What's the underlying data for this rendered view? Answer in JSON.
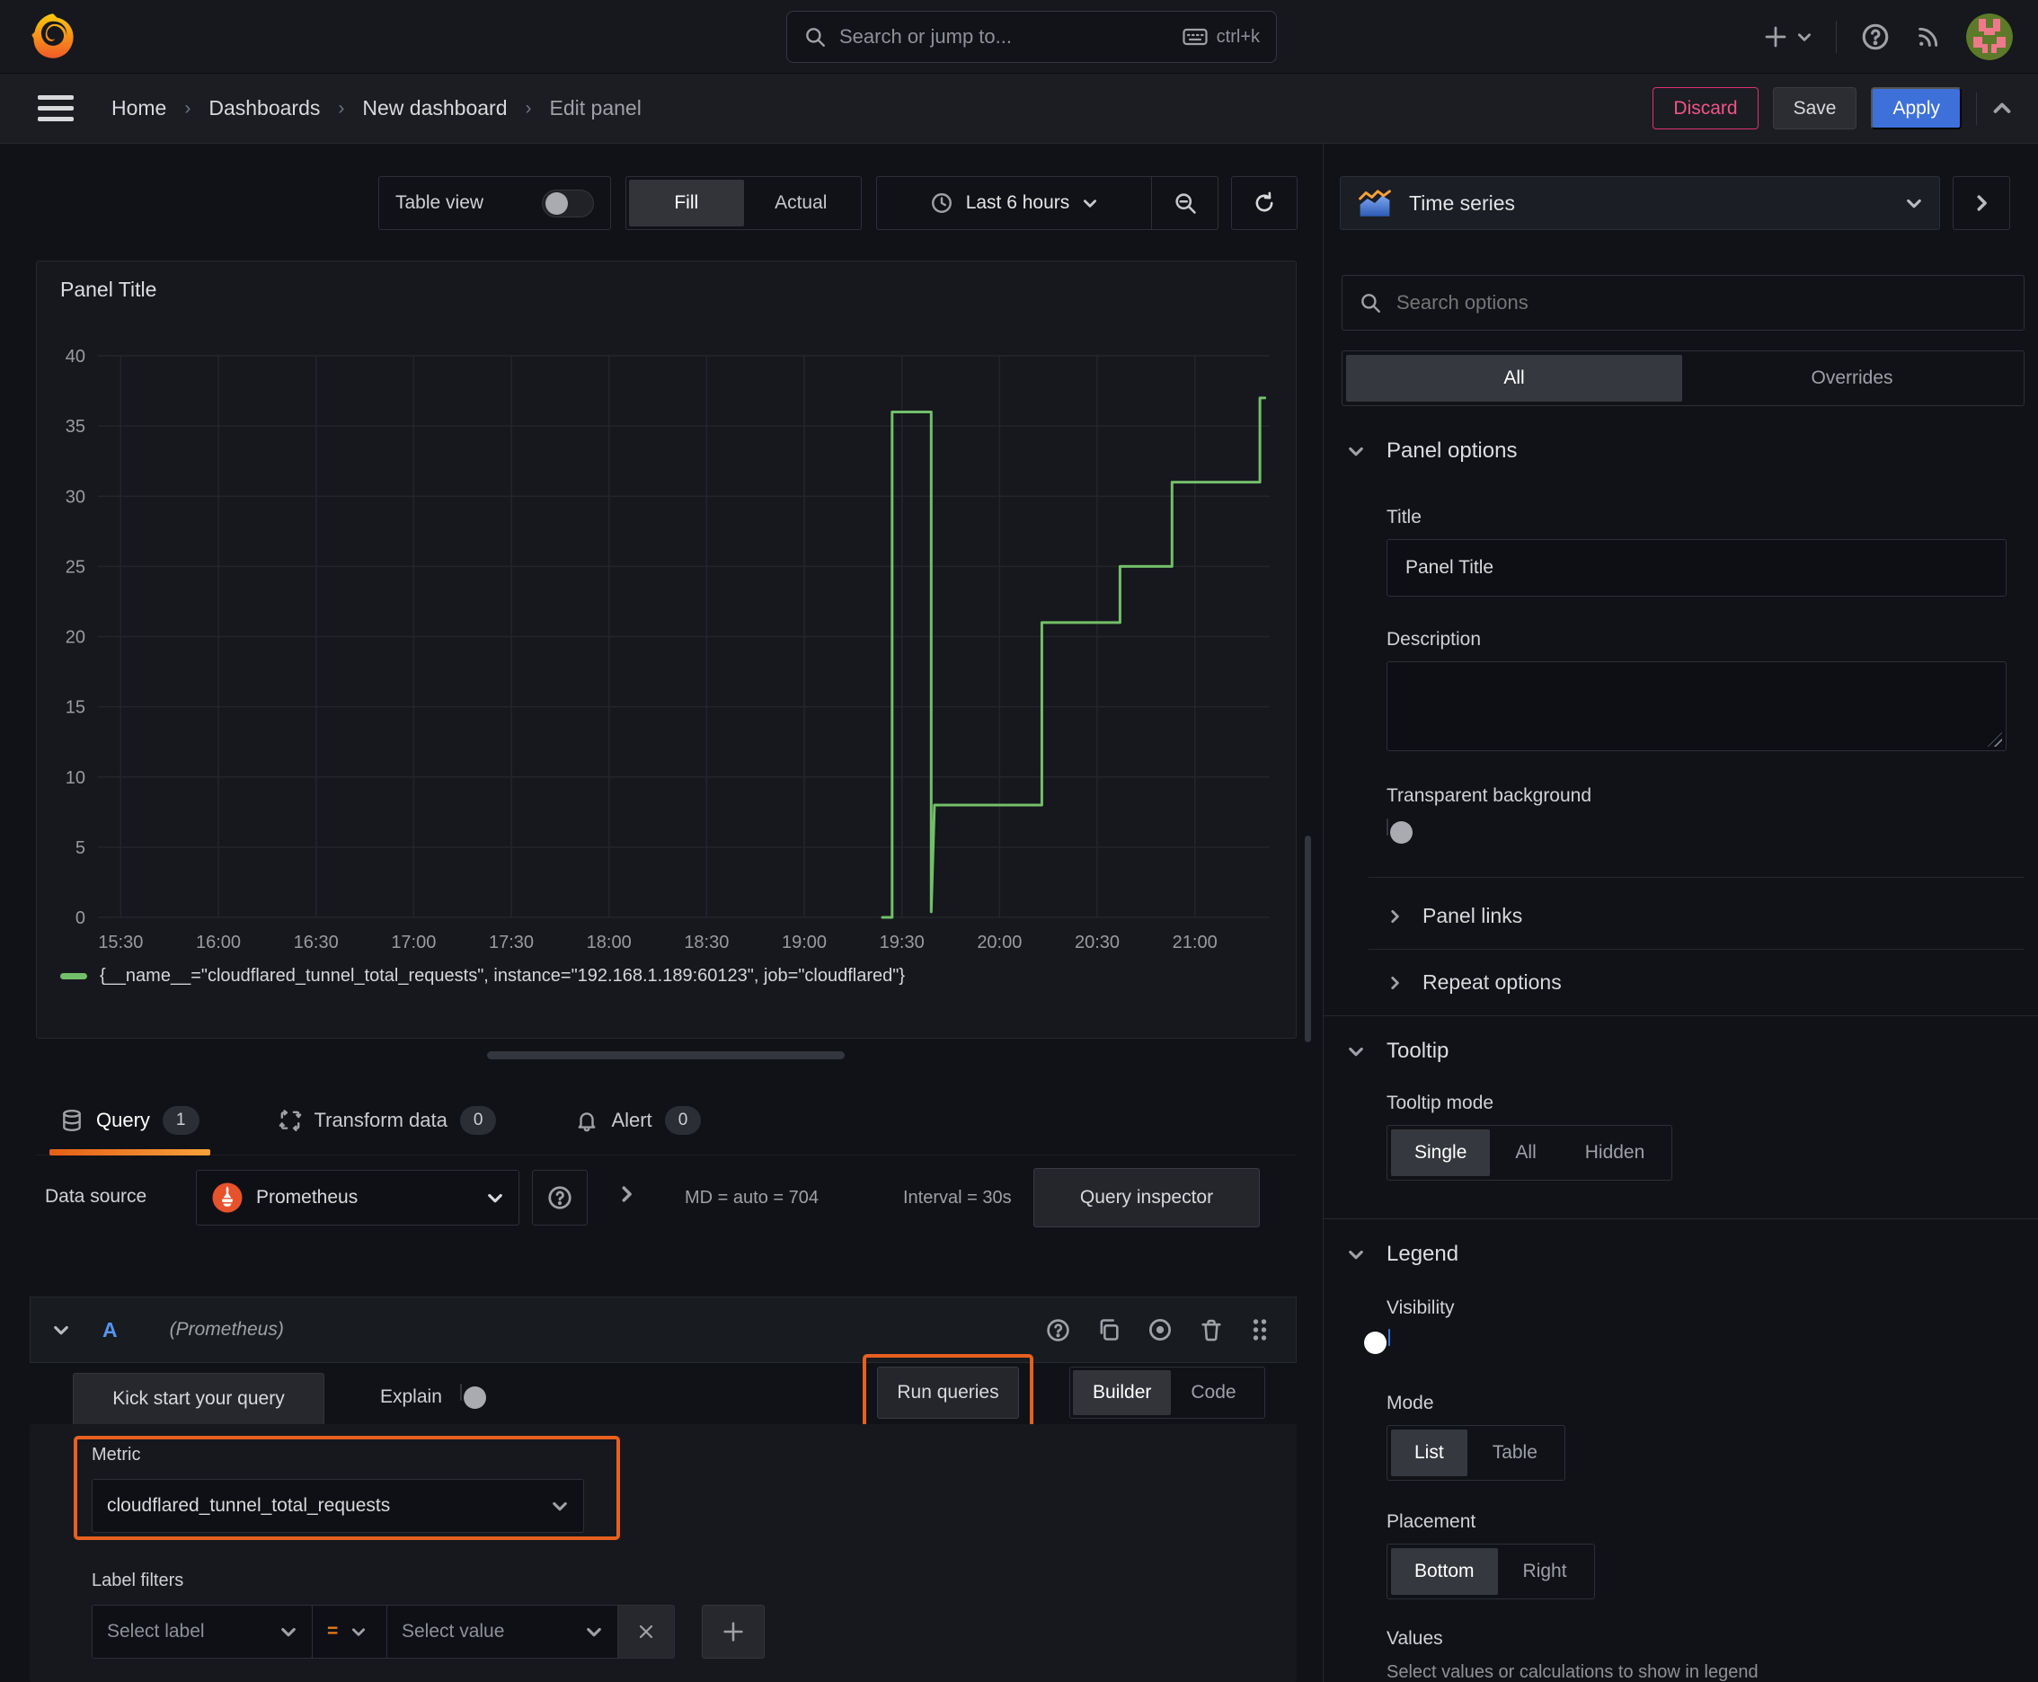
{
  "topbar": {
    "search_placeholder": "Search or jump to...",
    "shortcut": "ctrl+k"
  },
  "breadcrumb": {
    "items": [
      "Home",
      "Dashboards",
      "New dashboard"
    ],
    "current": "Edit panel"
  },
  "actions": {
    "discard": "Discard",
    "save": "Save",
    "apply": "Apply"
  },
  "toolbar": {
    "table_view": "Table view",
    "fill": "Fill",
    "actual": "Actual",
    "time_range": "Last 6 hours"
  },
  "panel": {
    "title": "Panel Title",
    "legend": "{__name__=\"cloudflared_tunnel_total_requests\", instance=\"192.168.1.189:60123\", job=\"cloudflared\"}"
  },
  "chart_data": {
    "type": "line",
    "style": "step",
    "title": "Panel Title",
    "xlabel": "",
    "ylabel": "",
    "ylim": [
      0,
      40
    ],
    "y_ticks": [
      0,
      5,
      10,
      15,
      20,
      25,
      30,
      35,
      40
    ],
    "x_ticks": [
      "15:30",
      "16:00",
      "16:30",
      "17:00",
      "17:30",
      "18:00",
      "18:30",
      "19:00",
      "19:30",
      "20:00",
      "20:30",
      "21:00"
    ],
    "x_tick_minutes": [
      0,
      30,
      60,
      90,
      120,
      150,
      180,
      210,
      240,
      270,
      300,
      330
    ],
    "x_domain_minutes": [
      -7,
      353
    ],
    "grid": true,
    "legend_position": "bottom",
    "series": [
      {
        "name": "{__name__=\"cloudflared_tunnel_total_requests\", instance=\"192.168.1.189:60123\", job=\"cloudflared\"}",
        "color": "#73bf69",
        "points": [
          {
            "t": "19:24",
            "m": 234,
            "v": 0
          },
          {
            "t": "19:27",
            "m": 237,
            "v": 0
          },
          {
            "t": "19:27",
            "m": 237,
            "v": 36
          },
          {
            "t": "19:39",
            "m": 249,
            "v": 36
          },
          {
            "t": "19:39",
            "m": 249,
            "v": 0.4
          },
          {
            "t": "19:40",
            "m": 250,
            "v": 8
          },
          {
            "t": "20:13",
            "m": 283,
            "v": 8
          },
          {
            "t": "20:13",
            "m": 283,
            "v": 21
          },
          {
            "t": "20:37",
            "m": 307,
            "v": 21
          },
          {
            "t": "20:37",
            "m": 307,
            "v": 25
          },
          {
            "t": "20:53",
            "m": 323,
            "v": 25
          },
          {
            "t": "20:53",
            "m": 323,
            "v": 31
          },
          {
            "t": "21:20",
            "m": 350,
            "v": 31
          },
          {
            "t": "21:20",
            "m": 350,
            "v": 37
          },
          {
            "t": "21:21",
            "m": 351.5,
            "v": 37
          }
        ]
      }
    ]
  },
  "tabs": [
    {
      "label": "Query",
      "count": "1"
    },
    {
      "label": "Transform data",
      "count": "0"
    },
    {
      "label": "Alert",
      "count": "0"
    }
  ],
  "query": {
    "datasource_label": "Data source",
    "datasource": "Prometheus",
    "stats_md": "MD = auto = 704",
    "stats_interval": "Interval = 30s",
    "inspector": "Query inspector",
    "ref_id": "A",
    "ds_hint": "(Prometheus)",
    "kickstart": "Kick start your query",
    "explain": "Explain",
    "run": "Run queries",
    "builder": "Builder",
    "code": "Code",
    "metric_label": "Metric",
    "metric_value": "cloudflared_tunnel_total_requests",
    "label_filters_label": "Label filters",
    "select_label": "Select label",
    "operator": "=",
    "select_value": "Select value"
  },
  "options": {
    "viz": "Time series",
    "search_placeholder": "Search options",
    "tab_all": "All",
    "tab_overrides": "Overrides",
    "panel_options": "Panel options",
    "title_label": "Title",
    "title_value": "Panel Title",
    "description_label": "Description",
    "transparent_label": "Transparent background",
    "panel_links": "Panel links",
    "repeat_options": "Repeat options",
    "tooltip": "Tooltip",
    "tooltip_mode": "Tooltip mode",
    "tooltip_modes": [
      "Single",
      "All",
      "Hidden"
    ],
    "legend": "Legend",
    "visibility": "Visibility",
    "mode": "Mode",
    "modes": [
      "List",
      "Table"
    ],
    "placement": "Placement",
    "placements": [
      "Bottom",
      "Right"
    ],
    "values_label": "Values",
    "values_hint": "Select values or calculations to show in legend"
  },
  "colors": {
    "accent_blue": "#3d71d9",
    "accent_orange": "#e6601f",
    "tab_underline": "#f9a13b",
    "series_green": "#73bf69",
    "discard_pink": "#e0316e",
    "prometheus_orange": "#e6522c"
  }
}
